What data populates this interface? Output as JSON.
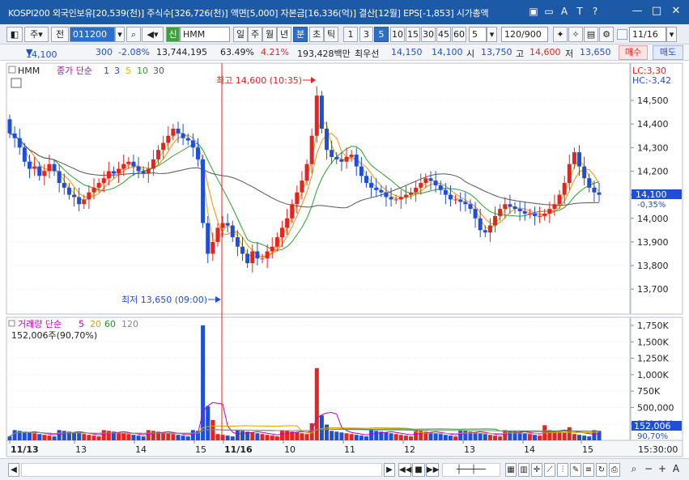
{
  "title": "KOSPI200 외국인보유[20,539(천)] 주식수[326,726(천)] 액면[5,000] 자본금[16,336(억)] 결산[12월] EPS[-1,853] 시가총액",
  "titlebar_icons": [
    "layout-icon",
    "minimize-panel-icon",
    "font-size-icon",
    "text-icon",
    "help-icon"
  ],
  "window_controls": [
    "minimize-icon",
    "maximize-icon",
    "close-icon"
  ],
  "toolbar": {
    "type_label": "주",
    "prev_label": "전",
    "code_value": "011200",
    "stock_badge": "신",
    "stock_name": "HMM",
    "period_buttons": [
      "일",
      "주",
      "월",
      "년",
      "분",
      "초",
      "틱"
    ],
    "period_active": "분",
    "interval_buttons": [
      "1",
      "3",
      "5",
      "10",
      "15",
      "30",
      "45",
      "60"
    ],
    "interval_active": "5",
    "interval_select": "5",
    "count_value": "120/900",
    "date_value": "11/16"
  },
  "quote": {
    "price": "14,100",
    "change": "300",
    "change_rate": "-2.08%",
    "volume": "13,744,195",
    "turnover": "63.49%",
    "other_rate": "4.21%",
    "amount": "193,428백만",
    "best_bid_label": "최우선",
    "best_bid": "14,150",
    "best_ask": "14,100",
    "open_label": "시",
    "open": "13,750",
    "high_label": "고",
    "high": "14,600",
    "low_label": "저",
    "low": "13,650",
    "buy_label": "매수",
    "sell_label": "매도"
  },
  "price_panel": {
    "symbol": "HMM",
    "legend_title": "종가 단순",
    "ma_periods": [
      "1",
      "3",
      "5",
      "10",
      "30"
    ],
    "lc_label": "LC:3,30",
    "hc_label": "HC:-3,42",
    "y_ticks": [
      "14,500",
      "14,400",
      "14,300",
      "14,200",
      "14,100",
      "14,000",
      "13,900",
      "13,800",
      "13,700"
    ],
    "current_price": "14,100",
    "current_change": "-0,35%",
    "high_note": "최고 14,600 (10:35)",
    "low_note": "최저 13,650 (09:00)"
  },
  "volume_panel": {
    "legend_title": "거래량 단순",
    "ma_periods": [
      "5",
      "20",
      "60",
      "120"
    ],
    "volume_text": "152,006주(90,70%)",
    "y_ticks": [
      "1,750K",
      "1,500K",
      "1,250K",
      "1,000K",
      "750K",
      "500,000",
      "250,000"
    ],
    "current_volume": "152,006",
    "current_pct": "90,70%"
  },
  "x_axis": {
    "labels": [
      "11/13",
      "13",
      "14",
      "15",
      "11/16",
      "10",
      "11",
      "12",
      "13",
      "14",
      "15"
    ],
    "time": "15:30:00"
  },
  "colors": {
    "up": "#e8231f",
    "down": "#1f4fd8",
    "ma1": "#ff8c00",
    "ma3": "#e1b000",
    "ma5": "#2aa12a",
    "ma10": "#1a7a1a",
    "ma30": "#555555",
    "vol5": "#c000c0",
    "vol20": "#e1a000",
    "vol60": "#1a9a1a",
    "vol120": "#888888"
  }
}
